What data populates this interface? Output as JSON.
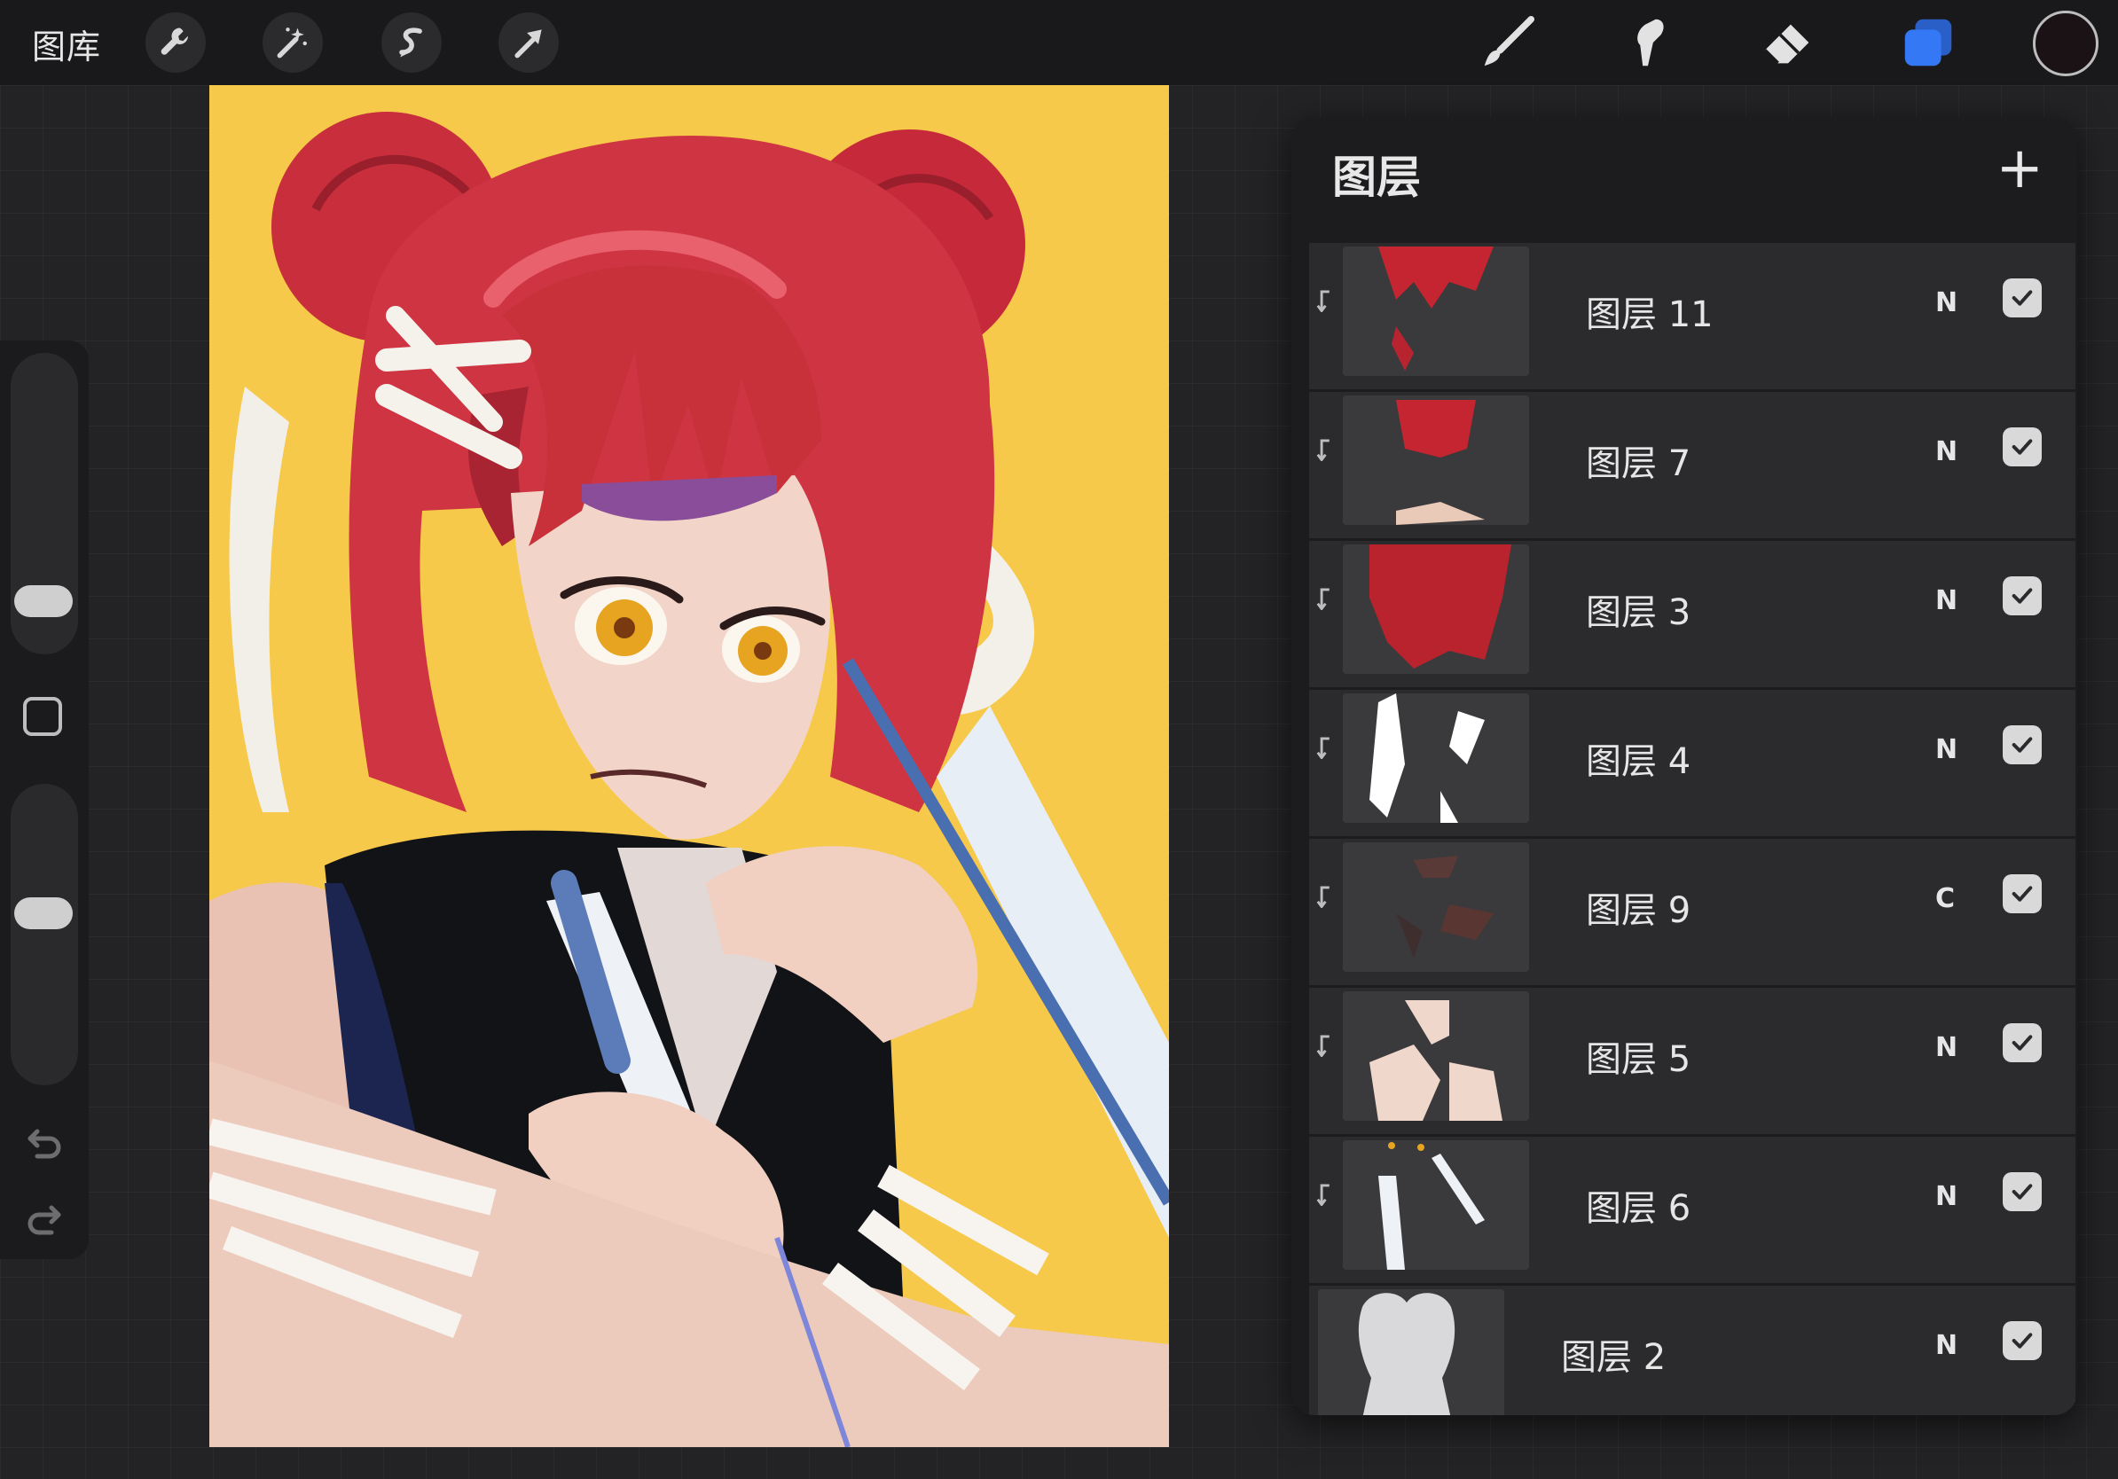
{
  "topbar": {
    "gallery_label": "图库",
    "left_tools": [
      {
        "name": "actions-wrench-icon"
      },
      {
        "name": "adjustments-magic-wand-icon"
      },
      {
        "name": "selection-icon"
      },
      {
        "name": "transform-arrow-icon"
      }
    ],
    "right_tools": [
      {
        "name": "brush-icon"
      },
      {
        "name": "smudge-icon"
      },
      {
        "name": "eraser-icon"
      },
      {
        "name": "layers-icon"
      }
    ],
    "accent_color": "#3478f6",
    "current_color": "#1a1214"
  },
  "sidebar": {
    "brush_size_level": 0.52,
    "opacity_level": 0.55
  },
  "layers_panel": {
    "title": "图层",
    "add_symbol": "+",
    "layers": [
      {
        "name": "图层 11",
        "mode": "N",
        "visible": true,
        "clipped": true
      },
      {
        "name": "图层 7",
        "mode": "N",
        "visible": true,
        "clipped": true
      },
      {
        "name": "图层 3",
        "mode": "N",
        "visible": true,
        "clipped": true
      },
      {
        "name": "图层 4",
        "mode": "N",
        "visible": true,
        "clipped": true
      },
      {
        "name": "图层 9",
        "mode": "C",
        "visible": true,
        "clipped": true
      },
      {
        "name": "图层 5",
        "mode": "N",
        "visible": true,
        "clipped": true
      },
      {
        "name": "图层 6",
        "mode": "N",
        "visible": true,
        "clipped": true
      },
      {
        "name": "图层 2",
        "mode": "N",
        "visible": true,
        "clipped": false
      }
    ]
  },
  "canvas": {
    "background_color": "#f7c94a",
    "hair_color": "#c8303a",
    "skin_color": "#f2d5c8"
  }
}
